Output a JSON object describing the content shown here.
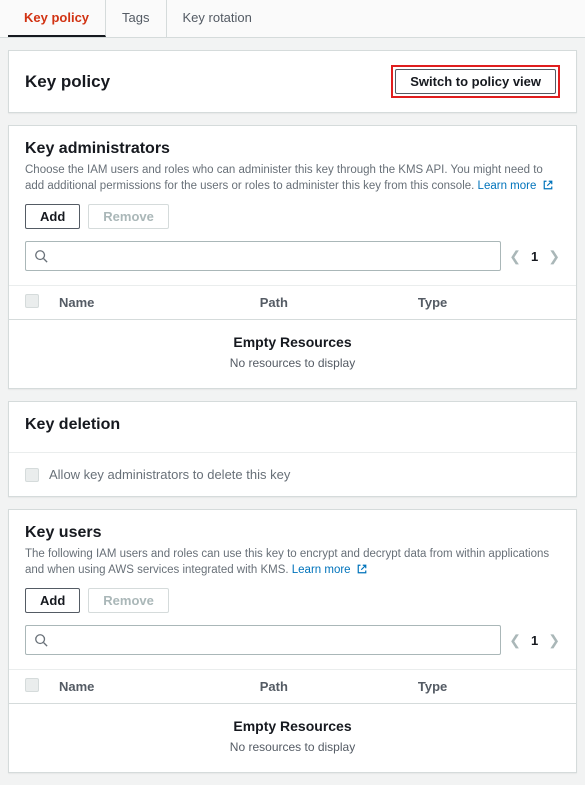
{
  "tabs": {
    "items": [
      {
        "label": "Key policy",
        "active": true
      },
      {
        "label": "Tags",
        "active": false
      },
      {
        "label": "Key rotation",
        "active": false
      }
    ]
  },
  "policyHeader": {
    "title": "Key policy",
    "switchButton": "Switch to policy view"
  },
  "admins": {
    "title": "Key administrators",
    "description": "Choose the IAM users and roles who can administer this key through the KMS API. You might need to add additional permissions for the users or roles to administer this key from this console.",
    "learnMore": "Learn more",
    "addButton": "Add",
    "removeButton": "Remove",
    "page": "1",
    "columns": {
      "name": "Name",
      "path": "Path",
      "type": "Type"
    },
    "emptyTitle": "Empty Resources",
    "emptyMsg": "No resources to display"
  },
  "deletion": {
    "title": "Key deletion",
    "checkboxLabel": "Allow key administrators to delete this key"
  },
  "users": {
    "title": "Key users",
    "description": "The following IAM users and roles can use this key to encrypt and decrypt data from within applications and when using AWS services integrated with KMS.",
    "learnMore": "Learn more",
    "addButton": "Add",
    "removeButton": "Remove",
    "page": "1",
    "columns": {
      "name": "Name",
      "path": "Path",
      "type": "Type"
    },
    "emptyTitle": "Empty Resources",
    "emptyMsg": "No resources to display"
  }
}
